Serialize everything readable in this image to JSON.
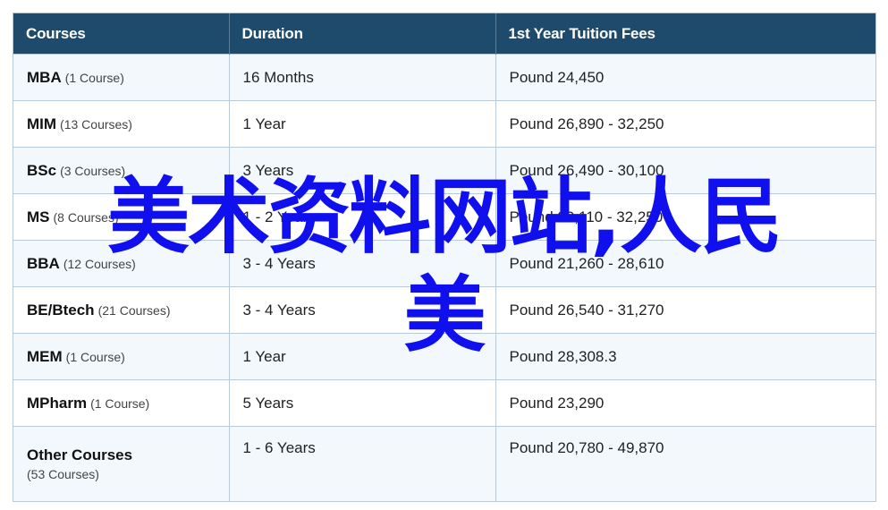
{
  "table": {
    "headers": [
      "Courses",
      "Duration",
      "1st Year Tuition Fees"
    ],
    "rows": [
      {
        "name": "MBA",
        "count": "(1 Course)",
        "duration": "16 Months",
        "fees": "Pound 24,450"
      },
      {
        "name": "MIM",
        "count": "(13 Courses)",
        "duration": "1 Year",
        "fees": "Pound 26,890 - 32,250"
      },
      {
        "name": "BSc",
        "count": "(3 Courses)",
        "duration": "3 Years",
        "fees": "Pound 26,490 - 30,100"
      },
      {
        "name": "MS",
        "count": "(8 Courses)",
        "duration": "1 - 2 Years",
        "fees": "Pound 20,110 - 32,250"
      },
      {
        "name": "BBA",
        "count": "(12 Courses)",
        "duration": "3 - 4 Years",
        "fees": "Pound 21,260 - 28,610"
      },
      {
        "name": "BE/Btech",
        "count": "(21 Courses)",
        "duration": "3 - 4 Years",
        "fees": "Pound 26,540 - 31,270"
      },
      {
        "name": "MEM",
        "count": "(1 Course)",
        "duration": "1 Year",
        "fees": "Pound 28,308.3"
      },
      {
        "name": "MPharm",
        "count": "(1 Course)",
        "duration": "5 Years",
        "fees": "Pound 23,290"
      },
      {
        "name": "Other Courses",
        "count": "(53 Courses)",
        "duration": "1 - 6 Years",
        "fees": "Pound 20,780 - 49,870"
      }
    ]
  },
  "overlay": {
    "line1": "美术资料网站,人民",
    "line2": "美"
  },
  "colors": {
    "header_bg": "#1e4b6b",
    "header_text": "#ffffff",
    "row_stripe": "#f2f8fc",
    "border": "#b9c9d6",
    "overlay_text": "#1010ee"
  }
}
